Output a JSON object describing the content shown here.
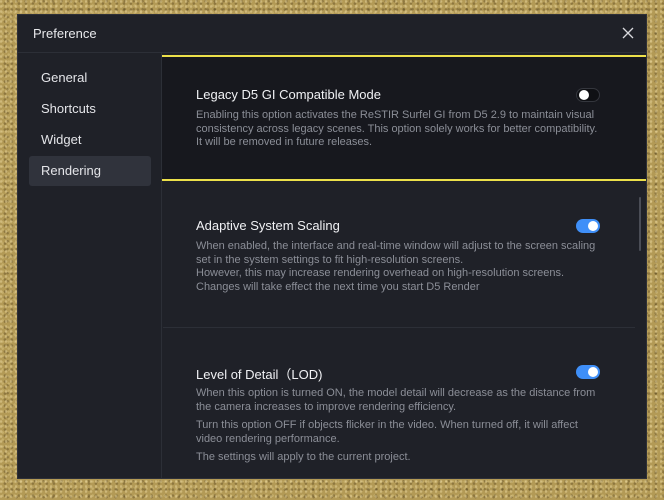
{
  "window": {
    "title": "Preference"
  },
  "sidebar": {
    "items": [
      {
        "label": "General"
      },
      {
        "label": "Shortcuts"
      },
      {
        "label": "Widget"
      },
      {
        "label": "Rendering"
      }
    ],
    "active": "Rendering"
  },
  "settings": [
    {
      "title": "Legacy D5 GI Compatible Mode",
      "enabled": false,
      "description": [
        "Enabling this option activates the ReSTIR Surfel GI from D5 2.9 to maintain visual consistency across legacy scenes. This option solely works for better compatibility. It will be removed in future releases."
      ]
    },
    {
      "title": "Adaptive System Scaling",
      "enabled": true,
      "description": [
        "When enabled, the interface and real-time window will adjust to the screen scaling set in the system settings to fit high-resolution screens.",
        "However, this may increase rendering overhead on high-resolution screens.",
        "Changes will take effect the next time you start D5 Render"
      ]
    },
    {
      "title": "Level of Detail（LOD)",
      "enabled": true,
      "description": [
        "When this option is turned ON, the model detail will decrease as the distance from the camera increases to improve rendering efficiency.",
        "Turn this option OFF if objects flicker in the video. When turned off, it will affect video rendering performance.",
        "The settings will apply to the current project."
      ]
    }
  ],
  "icons": {
    "close": "close-icon"
  },
  "colors": {
    "accent": "#3f8ff8",
    "highlight_border": "#ece04a",
    "background": "#1f2128"
  }
}
